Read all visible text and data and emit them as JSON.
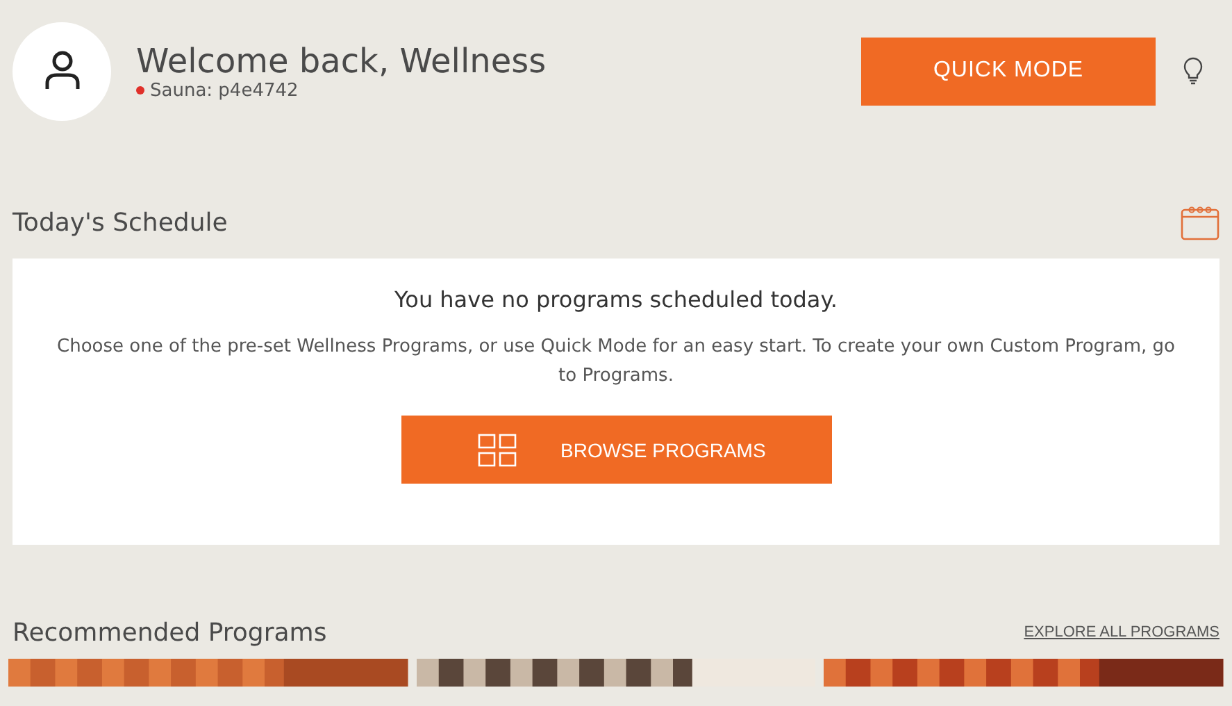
{
  "header": {
    "greeting": "Welcome back, Wellness",
    "sauna": {
      "label": "Sauna: p4e4742",
      "color": "#e0302a"
    },
    "quick_mode_button": "QUICK MODE"
  },
  "schedule": {
    "title": "Today's Schedule",
    "empty_title": "You have no programs scheduled today.",
    "empty_text": "Choose one of the pre-set Wellness Programs, or use Quick Mode for an easy start. To create your own Custom Program, go to Programs.",
    "browse_button": "BROWSE PROGRAMS"
  },
  "recommended": {
    "title": "Recommended Programs",
    "link": "EXPLORE ALL PROGRAMS"
  }
}
